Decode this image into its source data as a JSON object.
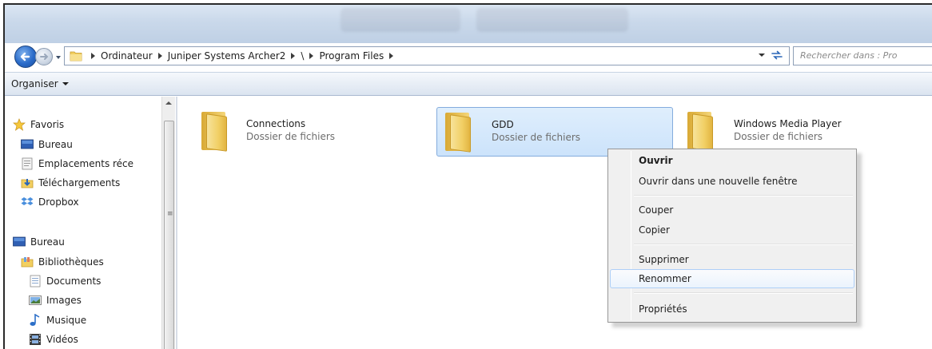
{
  "breadcrumbs": [
    "Ordinateur",
    "Juniper Systems Archer2",
    "\\",
    "Program Files"
  ],
  "search": {
    "placeholder": "Rechercher dans : Pro"
  },
  "toolbar": {
    "organise_label": "Organiser"
  },
  "nav": {
    "favorites": [
      {
        "label": "Favoris",
        "icon": "star-icon"
      },
      {
        "label": "Bureau",
        "icon": "desktop-icon"
      },
      {
        "label": "Emplacements réce",
        "icon": "recent-places-icon"
      },
      {
        "label": "Téléchargements",
        "icon": "downloads-icon"
      },
      {
        "label": "Dropbox",
        "icon": "dropbox-icon"
      }
    ],
    "tree": [
      {
        "label": "Bureau",
        "icon": "desktop-icon"
      },
      {
        "label": "Bibliothèques",
        "icon": "libraries-icon"
      },
      {
        "label": "Documents",
        "icon": "documents-icon"
      },
      {
        "label": "Images",
        "icon": "pictures-icon"
      },
      {
        "label": "Musique",
        "icon": "music-icon"
      },
      {
        "label": "Vidéos",
        "icon": "videos-icon"
      }
    ]
  },
  "files": [
    {
      "name": "Connections",
      "type": "Dossier de fichiers",
      "selected": false
    },
    {
      "name": "GDD",
      "type": "Dossier de fichiers",
      "selected": true
    },
    {
      "name": "Windows Media Player",
      "type": "Dossier de fichiers",
      "selected": false
    }
  ],
  "context_menu": {
    "items": [
      "Ouvrir",
      "Ouvrir dans une nouvelle fenêtre",
      "Couper",
      "Copier",
      "Supprimer",
      "Renommer",
      "Propriétés"
    ],
    "highlighted": "Renommer"
  },
  "colors": {
    "selection_bg": "#cce3fb",
    "selection_border": "#84acdd",
    "folder_yellow": "#f1cf64",
    "menu_bg": "#f0f0f0"
  }
}
